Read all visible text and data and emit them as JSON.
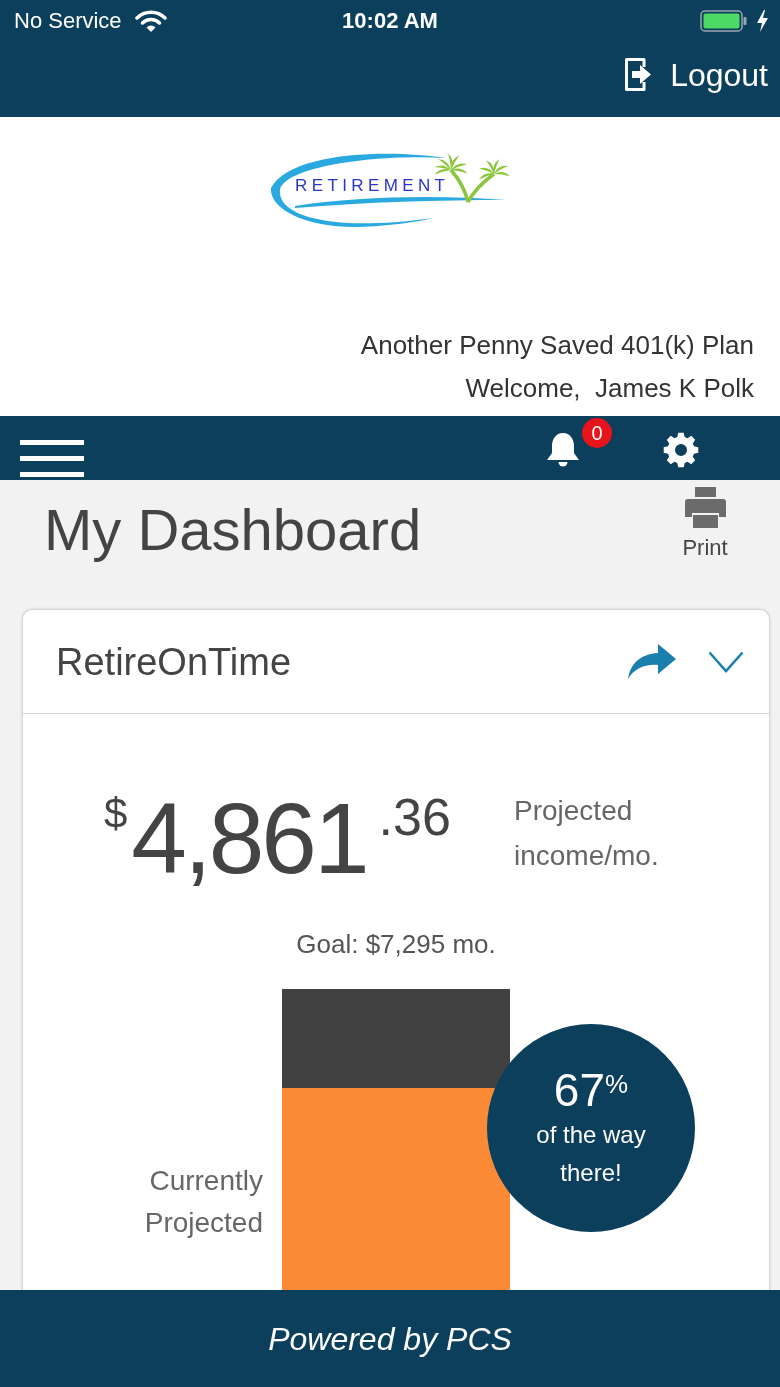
{
  "status_bar": {
    "carrier": "No Service",
    "time": "10:02 AM"
  },
  "top_bar": {
    "logout": "Logout"
  },
  "header": {
    "logo_text": "RETIREMENT",
    "plan_name": "Another Penny Saved 401(k) Plan",
    "welcome": "Welcome,  James K Polk"
  },
  "nav_bar": {
    "notification_count": "0"
  },
  "page": {
    "title": "My Dashboard",
    "print": "Print"
  },
  "card": {
    "title": "RetireOnTime",
    "amount": {
      "currency": "$",
      "whole": "4,861",
      "cents": ".36"
    },
    "amount_label": "Projected income/mo.",
    "goal": "Goal: $7,295 mo.",
    "meter": {
      "label": "Currently Projected",
      "level": 0.67
    },
    "progress": {
      "percent": "67$^{%}$",
      "caption": "of the way there!"
    }
  },
  "footer": {
    "text": "Powered by PCS"
  }
}
